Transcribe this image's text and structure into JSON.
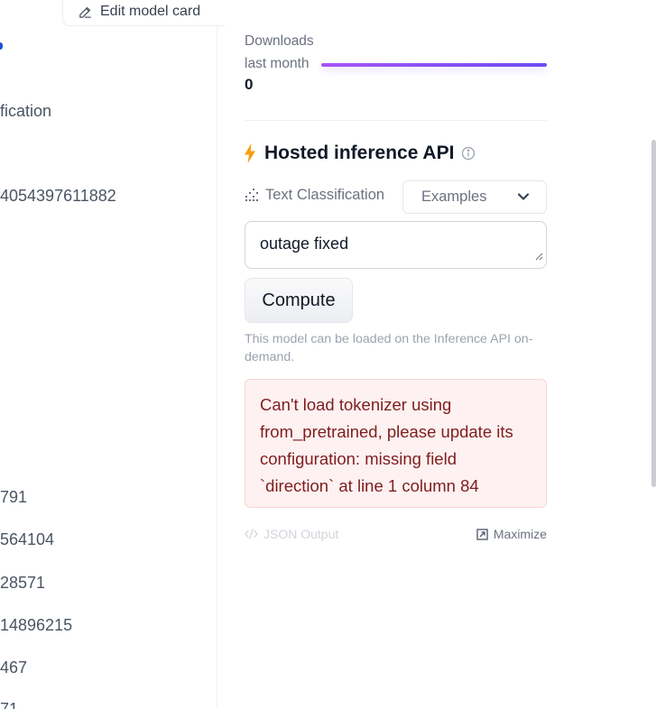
{
  "header": {
    "edit_model_card_label": "Edit model card"
  },
  "left_column": {
    "items": [
      "fication",
      "4054397611882",
      "791",
      "564104",
      "28571",
      "14896215",
      "467",
      "71"
    ]
  },
  "downloads": {
    "label_line1": "Downloads",
    "label_line2": "last month",
    "value": "0"
  },
  "inference": {
    "title": "Hosted inference API",
    "task_label": "Text Classification",
    "examples_label": "Examples",
    "input_value": "outage fixed",
    "compute_label": "Compute",
    "note": "This model can be loaded on the Inference API on-demand.",
    "error": "Can't load tokenizer using from_pretrained, please update its configuration: missing field `direction` at line 1 column 84",
    "json_output_label": "JSON Output",
    "maximize_label": "Maximize"
  },
  "colors": {
    "accent": "#7c3aed",
    "bolt": "#f59e0b",
    "error_bg": "#fef1f1",
    "error_text": "#7f1d1d"
  },
  "icons": [
    "pencil-icon",
    "bolt-icon",
    "info-icon",
    "text-classification-icon",
    "chevron-down-icon",
    "code-icon",
    "maximize-icon"
  ]
}
